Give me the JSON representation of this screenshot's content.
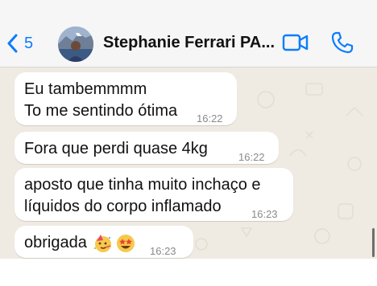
{
  "header": {
    "back_count": "5",
    "contact_name": "Stephanie Ferrari PA...",
    "accent_color": "#0b7cff",
    "icons": [
      "chevron-left-icon",
      "video-call-icon",
      "phone-icon"
    ]
  },
  "messages": [
    {
      "lines": [
        "Eu tambemmmm",
        "To me sentindo ótima"
      ],
      "time": "16:22"
    },
    {
      "lines": [
        "Fora que perdi quase 4kg"
      ],
      "time": "16:22"
    },
    {
      "lines": [
        "aposto que tinha muito inchaço e",
        "líquidos do corpo inflamado"
      ],
      "time": "16:23"
    },
    {
      "lines": [
        "obrigada"
      ],
      "emojis": [
        "partying-face-emoji",
        "star-struck-emoji"
      ],
      "time": "16:23"
    }
  ]
}
